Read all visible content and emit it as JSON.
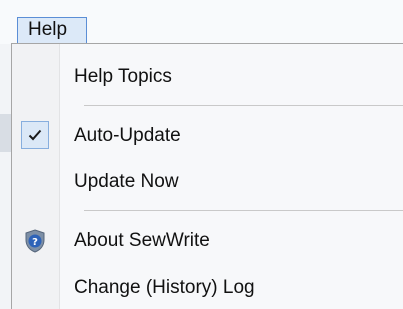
{
  "menubar": {
    "title": "Help"
  },
  "menu": {
    "items": [
      {
        "label": "Help Topics",
        "checked": false,
        "icon": null
      },
      {
        "label": "Auto-Update",
        "checked": true,
        "icon": "checkmark-icon"
      },
      {
        "label": "Update Now",
        "checked": false,
        "icon": null
      },
      {
        "label": "About SewWrite",
        "checked": false,
        "icon": "help-shield-icon"
      },
      {
        "label": "Change (History) Log",
        "checked": false,
        "icon": null
      }
    ]
  },
  "colors": {
    "menu_highlight": "#dce9f8",
    "menu_border": "#5b8ed6",
    "check_border": "#87aede",
    "shield_blue": "#2e63b8"
  }
}
